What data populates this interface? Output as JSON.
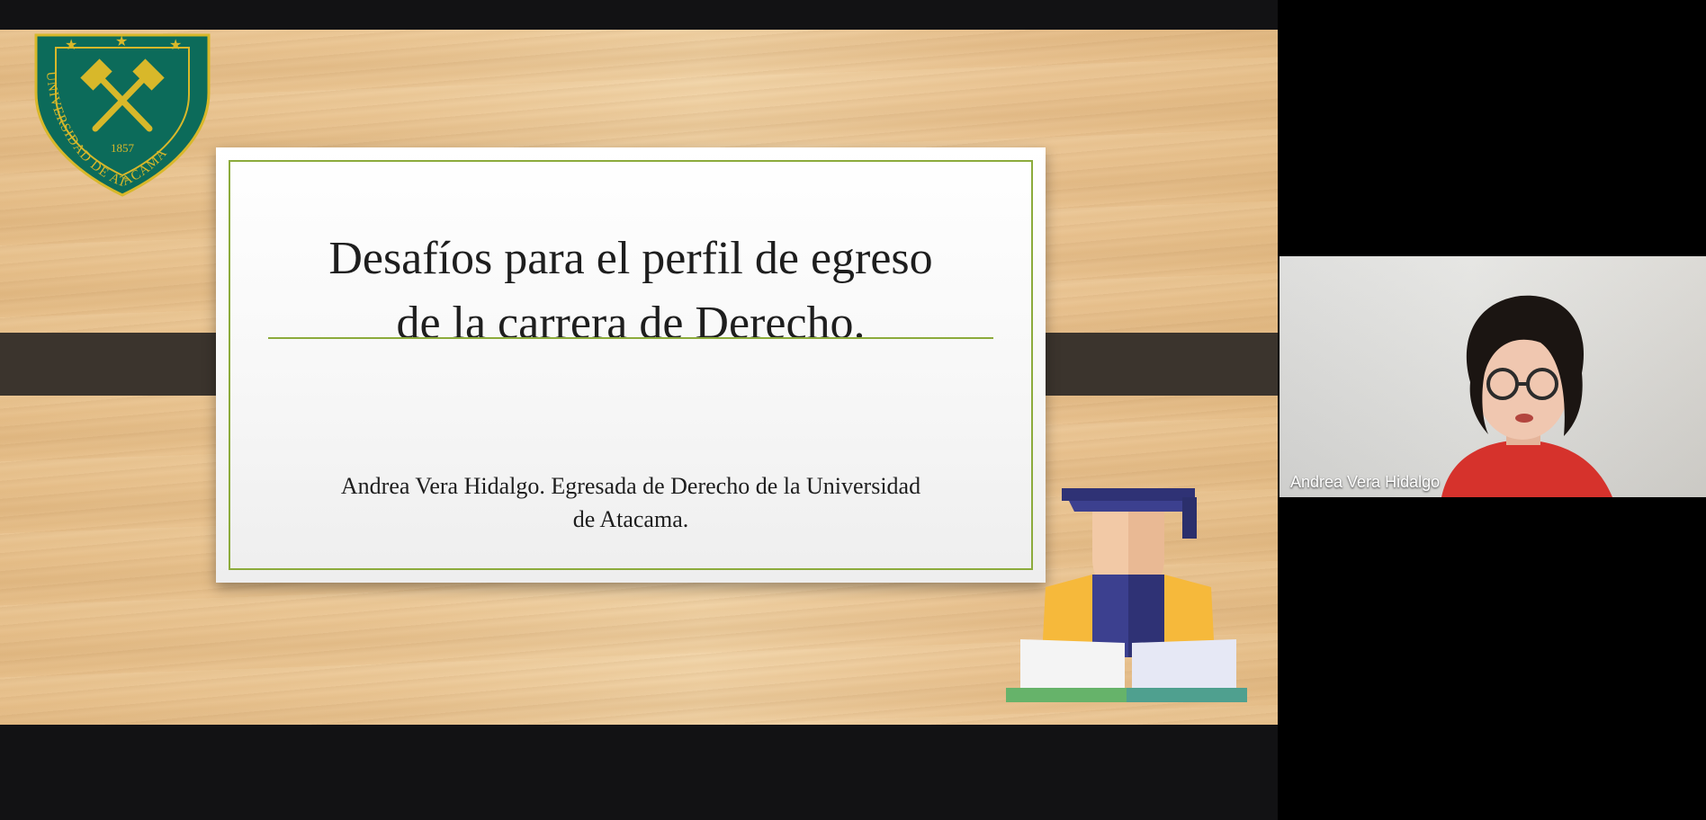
{
  "slide": {
    "logo": {
      "ring_text": "UNIVERSIDAD DE ATACAMA",
      "year": "1857",
      "icon": "crossed-hammers-icon",
      "colors": {
        "shield": "#0c6b5a",
        "gold": "#d8b82a"
      }
    },
    "title_line1": "Desafíos para el perfil de egreso",
    "title_line2": "de la carrera de Derecho.",
    "subtitle_line1": "Andrea Vera Hidalgo. Egresada de Derecho de la Universidad",
    "subtitle_line2": "de Atacama.",
    "decoration_icon": "graduate-icon",
    "colors": {
      "accent_rule": "#8cab3c",
      "band": "#3b342d"
    }
  },
  "participant": {
    "name": "Andrea Vera Hidalgo"
  }
}
